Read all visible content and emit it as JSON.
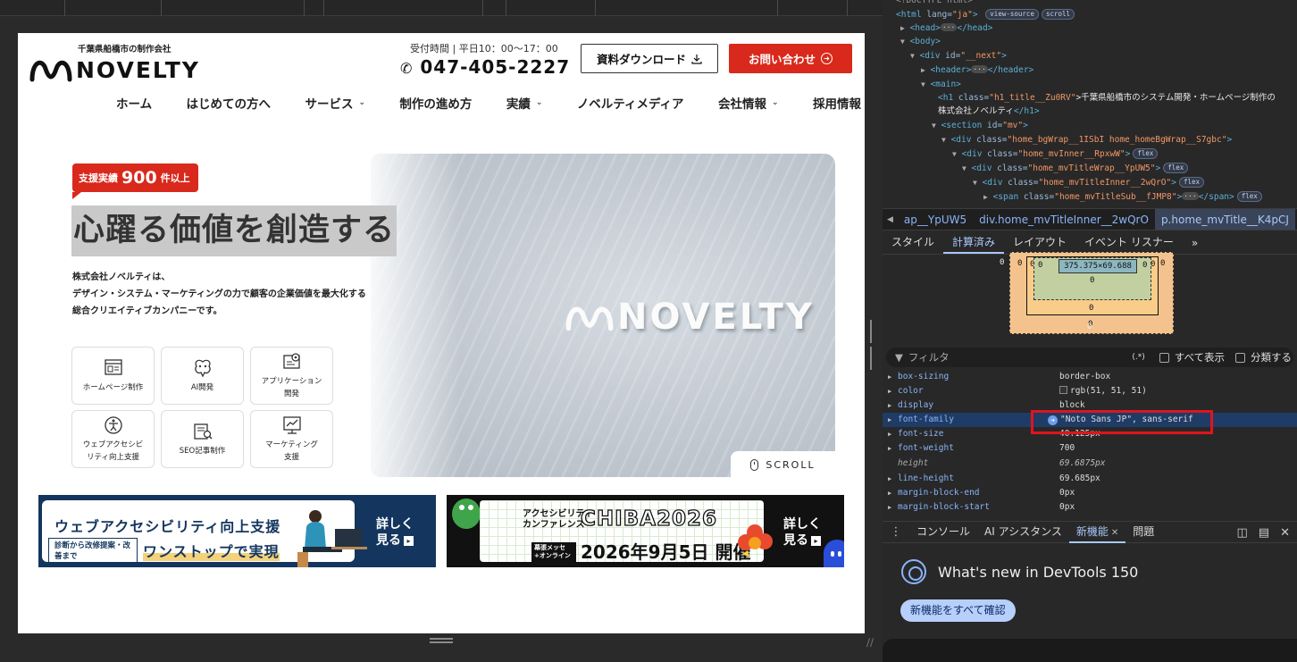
{
  "site": {
    "logo_sub": "千葉県船橋市の制作会社",
    "logo_name": "NOVELTY",
    "hours": "受付時間 | 平日10：00〜17：00",
    "phone": "047-405-2227",
    "download_label": "資料ダウンロード",
    "contact_label": "お問い合わせ",
    "nav": [
      {
        "label": "ホーム",
        "dropdown": false
      },
      {
        "label": "はじめての方へ",
        "dropdown": false
      },
      {
        "label": "サービス",
        "dropdown": true
      },
      {
        "label": "制作の進め方",
        "dropdown": false
      },
      {
        "label": "実績",
        "dropdown": true
      },
      {
        "label": "ノベルティメディア",
        "dropdown": false
      },
      {
        "label": "会社情報",
        "dropdown": true
      },
      {
        "label": "採用情報",
        "dropdown": false
      }
    ],
    "badge": {
      "label": "支援実績",
      "number": "900",
      "suffix": "件以上"
    },
    "headline": "心躍る価値を創造する",
    "intro": [
      "株式会社ノベルティは、",
      "デザイン・システム・マーケティングの力で顧客の企業価値を最大化する",
      "総合クリエイティブカンパニーです。"
    ],
    "hero_sign": "NOVELTY",
    "scroll_label": "SCROLL",
    "services": [
      {
        "label": "ホームページ制作",
        "icon": "website-icon"
      },
      {
        "label": "AI開発",
        "icon": "ai-brain-icon"
      },
      {
        "label": "アプリケーション\n開発",
        "icon": "app-gear-icon"
      },
      {
        "label": "ウェブアクセシビ\nリティ向上支援",
        "icon": "accessibility-icon"
      },
      {
        "label": "SEO記事制作",
        "icon": "seo-article-icon"
      },
      {
        "label": "マーケティング\n支援",
        "icon": "marketing-chart-icon"
      }
    ],
    "banner1": {
      "title": "ウェブアクセシビリティ向上支援",
      "sub": "診断から改修提案・改善まで",
      "onestop": "ワンストップで実現",
      "more_line1": "詳しく",
      "more_line2": "見る"
    },
    "banner2": {
      "line1a": "アクセシビリティ",
      "line1b": "カンファレンス",
      "chiba": "CHIBA2026",
      "venue": "幕張メッセ +オンライン",
      "date": "2026年9月5日 開催",
      "more_line1": "詳しく",
      "more_line2": "見る"
    }
  },
  "devtools": {
    "dom": {
      "l0": "<!DOCTYPE html>",
      "l1_tag": "<html",
      "l1_attr": " lang=",
      "l1_val": "\"ja\"",
      "l1_end": ">",
      "l1_pills": [
        "view-source",
        "scroll"
      ],
      "l2": "<head>",
      "l2_end": "</head>",
      "l3": "<body>",
      "l4_tag": "<div",
      "l4_attr": " id=",
      "l4_val": "\"__next\"",
      "l4_end": ">",
      "l5": "<header>",
      "l5_end": "</header>",
      "l6": "<main>",
      "l7_tag": "<h1",
      "l7_attr": " class=",
      "l7_val": "\"h1_title__Zu0RV\"",
      "l7_text": ">千葉県船橋市のシステム開発・ホームページ制作の",
      "l7b_text": "株式会社ノベルティ",
      "l7b_end": "</h1>",
      "l8_tag": "<section",
      "l8_attr": " id=",
      "l8_val": "\"mv\"",
      "l8_end": ">",
      "l9_tag": "<div",
      "l9_attr": " class=",
      "l9_val": "\"home_bgWrap__1ISbI home_homeBgWrap__S7gbc\"",
      "l9_end": ">",
      "l10_tag": "<div",
      "l10_attr": " class=",
      "l10_val": "\"home_mvInner__RpxwW\"",
      "l10_end": ">",
      "l11_tag": "<div",
      "l11_attr": " class=",
      "l11_val": "\"home_mvTitleWrap__YpUW5\"",
      "l11_end": ">",
      "l12_tag": "<div",
      "l12_attr": " class=",
      "l12_val": "\"home_mvTitleInner__2wQrO\"",
      "l12_end": ">",
      "l13_tag": "<span",
      "l13_attr": " class=",
      "l13_val": "\"home_mvTitleSub__fJMP8\"",
      "l13_end": "</span>",
      "flex": "flex"
    },
    "breadcrumbs": [
      "ap__YpUW5",
      "div.home_mvTitleInner__2wQrO",
      "p.home_mvTitle__K4pCJ"
    ],
    "tabs": [
      "スタイル",
      "計算済み",
      "レイアウト",
      "イベント リスナー"
    ],
    "active_tab": "計算済み",
    "box_model": {
      "content": "375.375×69.688",
      "margin": "0",
      "border": "0",
      "padding": "0",
      "position": "0"
    },
    "filter_placeholder": "フィルタ",
    "regex_label": "(.*)",
    "show_all_label": "すべて表示",
    "group_label": "分類する",
    "properties": [
      {
        "name": "box-sizing",
        "value": "border-box"
      },
      {
        "name": "color",
        "value": "rgb(51, 51, 51)"
      },
      {
        "name": "display",
        "value": "block"
      },
      {
        "name": "font-family",
        "value": "\"Noto Sans JP\", sans-serif"
      },
      {
        "name": "font-size",
        "value": "40.125px"
      },
      {
        "name": "font-weight",
        "value": "700"
      },
      {
        "name": "height",
        "value": "69.6875px"
      },
      {
        "name": "line-height",
        "value": "69.685px"
      },
      {
        "name": "margin-block-end",
        "value": "0px"
      },
      {
        "name": "margin-block-start",
        "value": "0px"
      }
    ],
    "drawer_tabs": [
      "コンソール",
      "AI アシスタンス",
      "新機能",
      "問題"
    ],
    "active_drawer_tab": "新機能",
    "whats_new_title": "What's new in DevTools 150",
    "whats_new_button": "新機能をすべて確認"
  },
  "colors": {
    "brand_red": "#d9291c",
    "navy": "#14365e",
    "devtools_accent": "#a8c7fa",
    "highlight_red": "#e0141e"
  }
}
